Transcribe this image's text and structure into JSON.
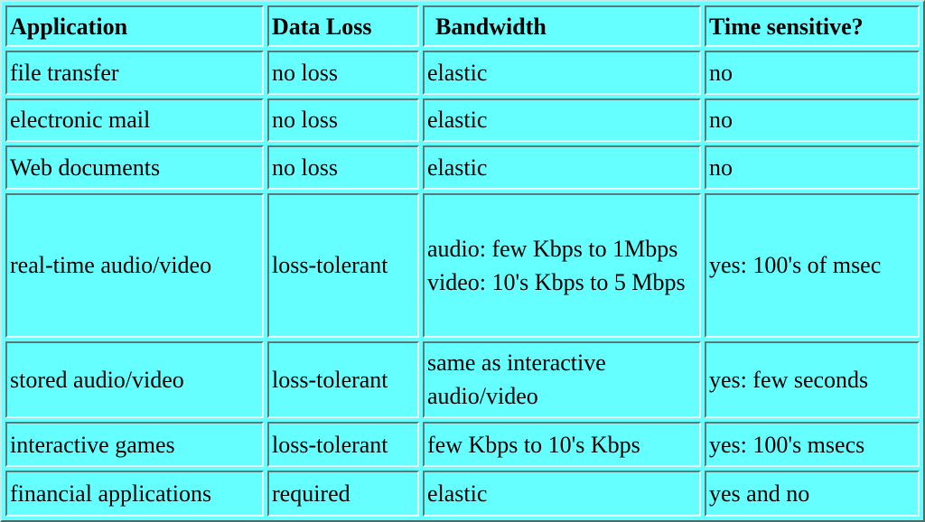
{
  "headers": [
    "Application",
    "Data Loss",
    "Bandwidth",
    "Time sensitive?"
  ],
  "rows": [
    {
      "application": "file transfer",
      "data_loss": "no loss",
      "bandwidth": [
        "elastic"
      ],
      "time_sensitive": "no"
    },
    {
      "application": "electronic mail",
      "data_loss": "no loss",
      "bandwidth": [
        "elastic"
      ],
      "time_sensitive": "no"
    },
    {
      "application": "Web documents",
      "data_loss": "no loss",
      "bandwidth": [
        "elastic"
      ],
      "time_sensitive": "no"
    },
    {
      "application": "real-time audio/video",
      "data_loss": "loss-tolerant",
      "bandwidth": [
        "audio: few Kbps to 1Mbps",
        "video: 10's Kbps to 5 Mbps"
      ],
      "time_sensitive": "yes: 100's of msec"
    },
    {
      "application": "stored audio/video",
      "data_loss": "loss-tolerant",
      "bandwidth": [
        "same as interactive audio/video"
      ],
      "time_sensitive": "yes: few seconds"
    },
    {
      "application": "interactive games",
      "data_loss": "loss-tolerant",
      "bandwidth": [
        "few Kbps to 10's Kbps"
      ],
      "time_sensitive": "yes: 100's msecs"
    },
    {
      "application": "financial applications",
      "data_loss": "required",
      "bandwidth": [
        "elastic"
      ],
      "time_sensitive": "yes and no"
    }
  ],
  "colors": {
    "background": "#66ffff"
  }
}
